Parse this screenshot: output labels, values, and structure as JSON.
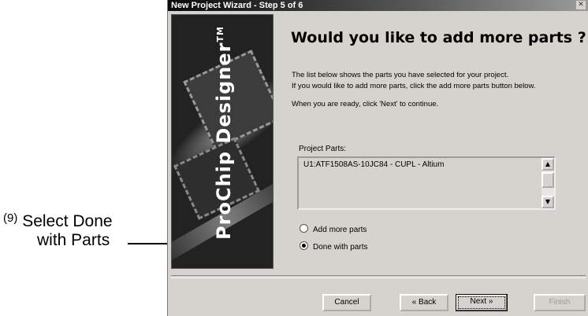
{
  "callout": {
    "number": "(9)",
    "line1": "Select Done",
    "line2": "with Parts"
  },
  "window": {
    "title": "New Project Wizard - Step 5 of 6",
    "close_glyph": "✕"
  },
  "banner": {
    "brand": "ProChip Designer",
    "trademark": "TM"
  },
  "content": {
    "heading": "Would you like to add more parts ?",
    "description_line1": "The list below shows the parts you have selected for your project.",
    "description_line2": "If you would like to add more parts, click the add more parts button below.",
    "instruction": "When you are ready, click 'Next' to continue."
  },
  "project_parts": {
    "label": "Project Parts:",
    "items": [
      "U1:ATF1508AS-10JC84 - CUPL - Altium"
    ]
  },
  "options": [
    {
      "label": "Add more parts",
      "selected": false
    },
    {
      "label": "Done with parts",
      "selected": true
    }
  ],
  "buttons": {
    "cancel": "Cancel",
    "back": "« Back",
    "next": "Next »",
    "finish": "Finish"
  }
}
